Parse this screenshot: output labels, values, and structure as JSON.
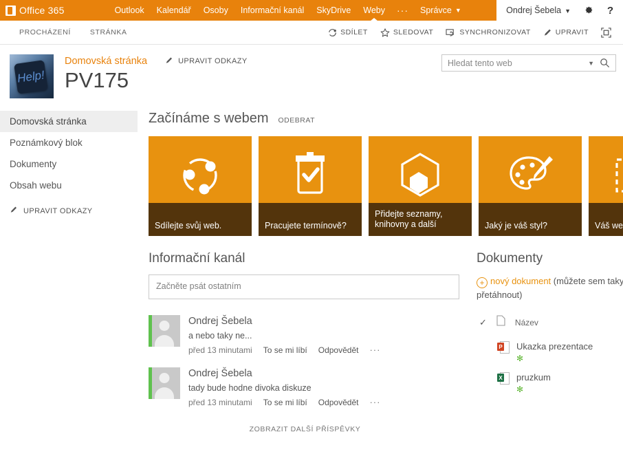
{
  "suite": {
    "brand": "Office 365",
    "brand_icon": "office-logo-icon",
    "nav": [
      {
        "label": "Outlook",
        "active": false
      },
      {
        "label": "Kalendář",
        "active": false
      },
      {
        "label": "Osoby",
        "active": false
      },
      {
        "label": "Informační kanál",
        "active": false
      },
      {
        "label": "SkyDrive",
        "active": false
      },
      {
        "label": "Weby",
        "active": true
      }
    ],
    "overflow": "···",
    "admin": "Správce",
    "user": "Ondrej Šebela",
    "settings_icon": "gear-icon",
    "help_icon": "question-mark-icon",
    "bar_color": "#e8820c"
  },
  "ribbon": {
    "tabs": [
      {
        "label": "PROCHÁZENÍ"
      },
      {
        "label": "STRÁNKA"
      }
    ],
    "actions": [
      {
        "label": "SDÍLET",
        "icon": "share-icon"
      },
      {
        "label": "SLEDOVAT",
        "icon": "star-icon"
      },
      {
        "label": "SYNCHRONIZOVAT",
        "icon": "sync-icon"
      },
      {
        "label": "UPRAVIT",
        "icon": "pencil-icon"
      },
      {
        "label": "",
        "icon": "focus-on-content-icon"
      }
    ]
  },
  "site": {
    "logo_alt": "Help!",
    "logo_key_text": "Help!",
    "breadcrumb": "Domovská stránka",
    "edit_links": "UPRAVIT ODKAZY",
    "title": "PV175"
  },
  "search": {
    "placeholder": "Hledat tento web",
    "value": "",
    "caret_icon": "chevron-down-icon",
    "go_icon": "search-icon"
  },
  "quicklaunch": {
    "items": [
      {
        "label": "Domovská stránka",
        "selected": true
      },
      {
        "label": "Poznámkový blok",
        "selected": false
      },
      {
        "label": "Dokumenty",
        "selected": false
      },
      {
        "label": "Obsah webu",
        "selected": false
      }
    ],
    "edit_links": "UPRAVIT ODKAZY",
    "edit_icon": "pencil-icon"
  },
  "getting_started": {
    "title": "Začínáme s webem",
    "remove": "ODEBRAT",
    "prev_icon": "chevron-left-icon",
    "next_icon": "chevron-right-icon",
    "tiles": [
      {
        "label": "Sdílejte svůj web.",
        "icon": "share-circle-icon"
      },
      {
        "label": "Pracujete termínově?",
        "icon": "clipboard-check-icon"
      },
      {
        "label": "Přidejte seznamy, knihovny a další",
        "icon": "hexagon-box-icon"
      },
      {
        "label": "Jaký je váš styl?",
        "icon": "palette-brush-icon"
      },
      {
        "label": "Váš web",
        "icon": "layout-icon"
      }
    ]
  },
  "feed": {
    "title": "Informační kanál",
    "composer_placeholder": "Začněte psát ostatním",
    "composer_value": "",
    "posts": [
      {
        "author": "Ondrej Šebela",
        "text": "a nebo taky ne...",
        "time": "před 13 minutami",
        "like": "To se mi líbí",
        "reply": "Odpovědět",
        "more": "···"
      },
      {
        "author": "Ondrej Šebela",
        "text": "tady bude hodne divoka diskuze",
        "time": "před 13 minutami",
        "like": "To se mi líbí",
        "reply": "Odpovědět",
        "more": "···"
      }
    ],
    "more_posts": "ZOBRAZIT DALŠÍ PŘÍSPĚVKY"
  },
  "documents": {
    "title": "Dokumenty",
    "new_doc_link": "nový dokument",
    "new_doc_suffix": " (můžete sem taky soubory přetáhnout)",
    "column_name": "Název",
    "select_all_icon": "check-icon",
    "type_icon": "file-icon",
    "rows": [
      {
        "name": "Ukazka prezentace",
        "type": "powerpoint",
        "type_letter": "P",
        "type_color": "#d04423",
        "new_badge": "✻",
        "more": "···"
      },
      {
        "name": "pruzkum",
        "type": "excel",
        "type_letter": "X",
        "type_color": "#1e7145",
        "new_badge": "✻",
        "more": "···"
      }
    ]
  }
}
